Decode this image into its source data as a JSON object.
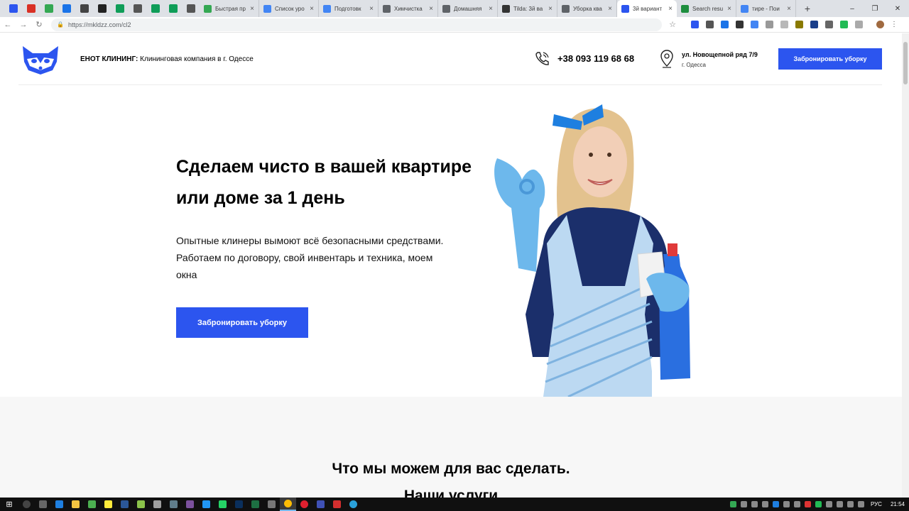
{
  "browser": {
    "tabs": [
      {
        "title": "Быстрая пр",
        "icon": "google-drive-icon",
        "color": "#34a853"
      },
      {
        "title": "Список уро",
        "icon": "google-docs-icon",
        "color": "#4285f4"
      },
      {
        "title": "Подготовк",
        "icon": "google-docs-icon",
        "color": "#4285f4"
      },
      {
        "title": "Химчистка",
        "icon": "globe-icon",
        "color": "#5f6368"
      },
      {
        "title": "Домашняя",
        "icon": "globe-icon",
        "color": "#5f6368"
      },
      {
        "title": "Tilda: 3й ва",
        "icon": "tilda-icon",
        "color": "#333333"
      },
      {
        "title": "Уборка ква",
        "icon": "globe-icon",
        "color": "#5f6368"
      },
      {
        "title": "3й вариант",
        "icon": "site-icon",
        "color": "#2c55ef",
        "active": true
      },
      {
        "title": "Search resu",
        "icon": "search-results-icon",
        "color": "#1e8e3e"
      },
      {
        "title": "тире - Пои",
        "icon": "google-icon",
        "color": "#4285f4"
      }
    ],
    "new_tab_label": "+",
    "window_controls": [
      "–",
      "❐",
      "✕"
    ],
    "url": "https://mkldzz.com/cl2",
    "pinned_colors": [
      "#2c55ef",
      "#d93025",
      "#34a853",
      "#1a73e8",
      "#444444",
      "#222222",
      "#0f9d58",
      "#555555",
      "#0f9d58",
      "#0f9d58",
      "#555555"
    ]
  },
  "site": {
    "brand_bold": "ЕНОТ КЛИНИНГ:",
    "brand_rest": " Клининговая компания в г. Одессе",
    "phone": "+38 093 119 68 68",
    "address_line1": "ул. Новощепной ряд 7/9",
    "address_line2": "г. Одесса",
    "header_button": "Забронировать уборку",
    "accent_color": "#2c55ef"
  },
  "hero": {
    "title": "Сделаем чисто в вашей квартире или доме за 1 день",
    "subtitle": "Опытные клинеры вымоют всё безопасными средствами. Работаем по договору, свой инвентарь и техника, моем окна",
    "cta": "Забронировать уборку"
  },
  "services": {
    "title": "Что мы можем для вас сделать.",
    "subtitle": "Наши услуги"
  },
  "taskbar": {
    "language": "РУС",
    "time": "21:54"
  }
}
